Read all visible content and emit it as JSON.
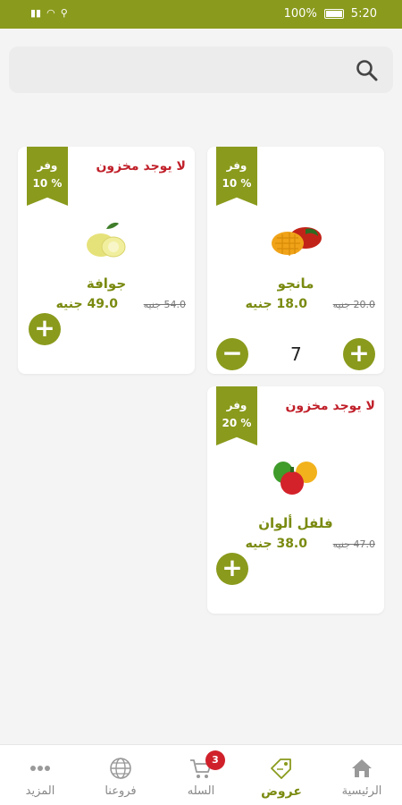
{
  "status_bar": {
    "battery": "100%",
    "time": "5:20"
  },
  "search": {
    "placeholder": ""
  },
  "products": [
    {
      "name": "جوافة",
      "discount_label": "وفر",
      "discount": "10 %",
      "stock_note": "لا يوجد مخزون",
      "old_price": "54.0 جنيه",
      "new_price": "49.0 جنيه"
    },
    {
      "name": "مانجو",
      "discount_label": "وفر",
      "discount": "10 %",
      "stock_note": "",
      "old_price": "20.0 جنيه",
      "new_price": "18.0 جنيه",
      "quantity": "7"
    },
    {
      "name": "فلفل ألوان",
      "discount_label": "وفر",
      "discount": "20 %",
      "stock_note": "لا يوجد مخزون",
      "old_price": "47.0 جنيه",
      "new_price": "38.0 جنيه"
    }
  ],
  "bottom_nav": {
    "items": [
      {
        "label": "المزيد",
        "icon": "more-icon"
      },
      {
        "label": "فروعنا",
        "icon": "globe-icon"
      },
      {
        "label": "السله",
        "icon": "cart-icon",
        "badge": "3"
      },
      {
        "label": "عروض",
        "icon": "offers-tag-icon",
        "active": true
      },
      {
        "label": "الرئيسية",
        "icon": "home-icon"
      }
    ]
  },
  "colors": {
    "primary": "#8a9a1c",
    "alert": "#c0202a",
    "badge": "#d0212b"
  }
}
